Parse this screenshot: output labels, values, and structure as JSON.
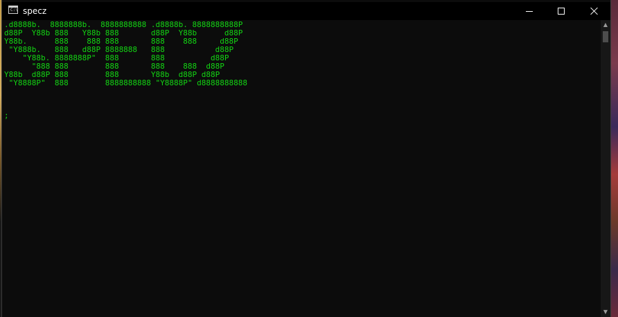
{
  "window": {
    "title": "specz",
    "minimize_glyph": "",
    "maximize_glyph": "",
    "close_glyph": ""
  },
  "console": {
    "lines": [
      ".d8888b.  8888888b.  8888888888 .d8888b. 8888888888P",
      "d88P  Y88b 888   Y88b 888       d88P  Y88b      d88P",
      "Y88b.      888    888 888       888    888     d88P",
      " \"Y888b.   888   d88P 8888888   888           d88P",
      "    \"Y88b. 8888888P\"  888       888          d88P",
      "      \"888 888        888       888    888  d88P",
      "Y88b  d88P 888        888       Y88b  d88P d88P",
      " \"Y8888P\"  888        8888888888 \"Y8888P\" d8888888888"
    ],
    "cursor": ";"
  },
  "scrollbar": {
    "up_arrow": "▲",
    "down_arrow": "▼"
  },
  "colors": {
    "console_text": "#13d613",
    "console_background": "#0c0c0c",
    "titlebar_background": "#000000"
  }
}
